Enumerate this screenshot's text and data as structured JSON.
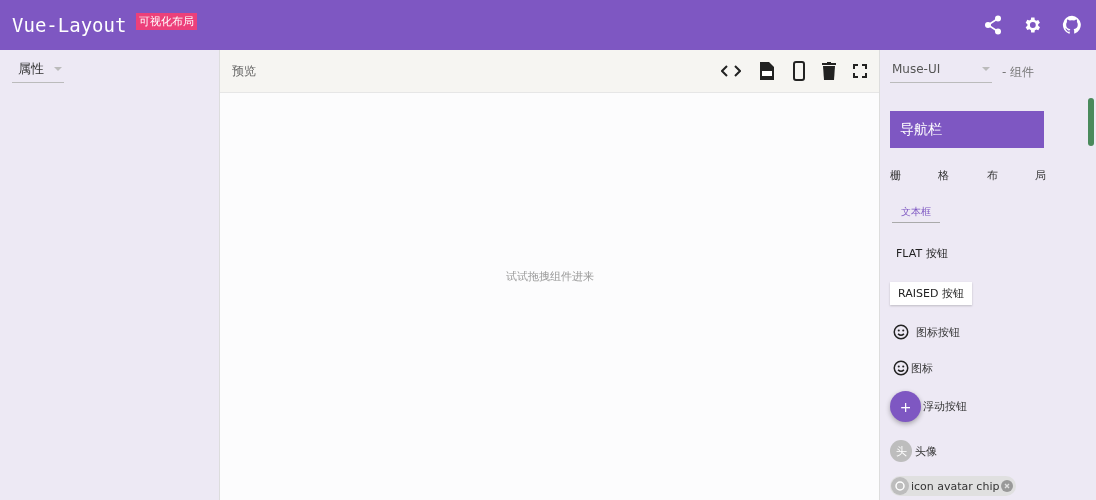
{
  "header": {
    "title": "Vue-Layout",
    "badge": "可视化布局"
  },
  "left_panel": {
    "select": {
      "value": "属性"
    }
  },
  "preview": {
    "title": "预览",
    "placeholder_text": "试试拖拽组件进来"
  },
  "component_panel": {
    "library": {
      "value": "Muse-UI"
    },
    "suffix": "- 组件",
    "components": [
      {
        "kind": "navbar",
        "label": "导航栏"
      },
      {
        "kind": "grid",
        "cells": [
          "栅",
          "格",
          "布",
          "局"
        ]
      },
      {
        "kind": "textfield",
        "label": "文本框"
      },
      {
        "kind": "flat",
        "label": "FLAT 按钮"
      },
      {
        "kind": "raised",
        "label": "RAISED 按钮"
      },
      {
        "kind": "iconbutton",
        "label": "图标按钮"
      },
      {
        "kind": "icon",
        "label": "图标"
      },
      {
        "kind": "fab",
        "symbol": "+",
        "label": "浮动按钮"
      },
      {
        "kind": "avatar",
        "initial": "头",
        "label": "头像"
      },
      {
        "kind": "chip",
        "label": "icon avatar chip"
      }
    ]
  }
}
